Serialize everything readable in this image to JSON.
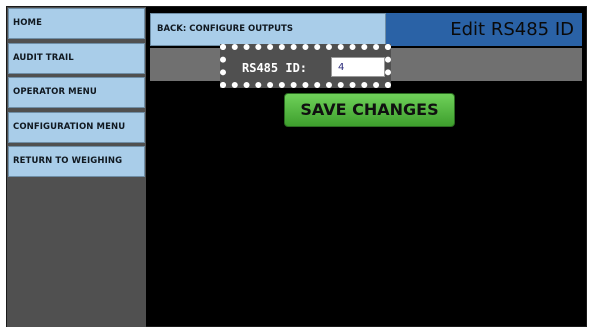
{
  "sidebar": {
    "items": [
      {
        "label": "HOME"
      },
      {
        "label": "AUDIT TRAIL"
      },
      {
        "label": "OPERATOR MENU"
      },
      {
        "label": "CONFIGURATION MENU"
      },
      {
        "label": "RETURN TO WEIGHING"
      }
    ]
  },
  "header": {
    "back_label": "BACK: CONFIGURE OUTPUTS",
    "title": "Edit RS485 ID"
  },
  "form": {
    "rs485_label": "RS485 ID:",
    "rs485_value": "4"
  },
  "actions": {
    "save_label": "SAVE CHANGES"
  },
  "colors": {
    "nav_button": "#a9cde9",
    "title_bar": "#2a62a6",
    "save_button": "#4cb83a",
    "background": "#000000"
  }
}
